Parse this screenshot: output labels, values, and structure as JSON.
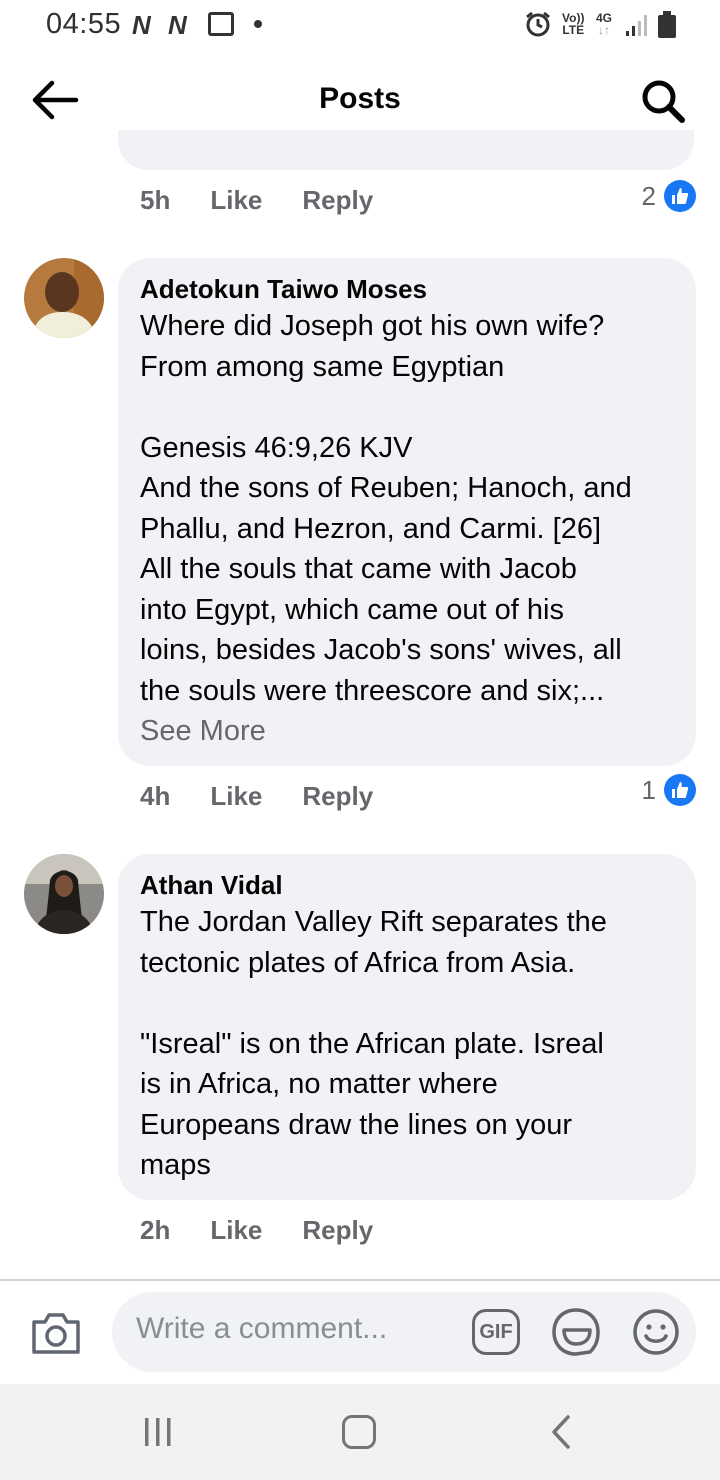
{
  "status_bar": {
    "time": "04:55",
    "notif_1": "N",
    "notif_2": "N",
    "volte_top": "Vo))",
    "volte_bottom": "LTE",
    "network": "4G"
  },
  "header": {
    "title": "Posts"
  },
  "previous_comment": {
    "time": "5h",
    "like_label": "Like",
    "reply_label": "Reply",
    "reaction_count": "2"
  },
  "comments": [
    {
      "author": "Adetokun Taiwo Moses",
      "text": "Where did Joseph got his own wife?\nFrom among same Egyptian\n\nGenesis 46:9,26 KJV\nAnd the sons of Reuben; Hanoch, and\nPhallu, and Hezron, and Carmi. [26]\nAll the souls that came with Jacob\ninto Egypt, which came out of his\nloins, besides Jacob's sons' wives, all\nthe souls were threescore and six;...",
      "see_more": "See More",
      "time": "4h",
      "like_label": "Like",
      "reply_label": "Reply",
      "reaction_count": "1"
    },
    {
      "author": "Athan Vidal",
      "text": "The Jordan Valley Rift separates the\ntectonic plates of Africa from Asia.\n\n\"Isreal\" is on the African plate. Isreal\nis in Africa, no matter where\nEuropeans draw the lines on your\nmaps",
      "time": "2h",
      "like_label": "Like",
      "reply_label": "Reply"
    }
  ],
  "composer": {
    "placeholder": "Write a comment...",
    "gif_label": "GIF"
  },
  "colors": {
    "bubble": "#f0f2f5",
    "secondary_text": "#65676b",
    "like_blue": "#1877f2"
  }
}
